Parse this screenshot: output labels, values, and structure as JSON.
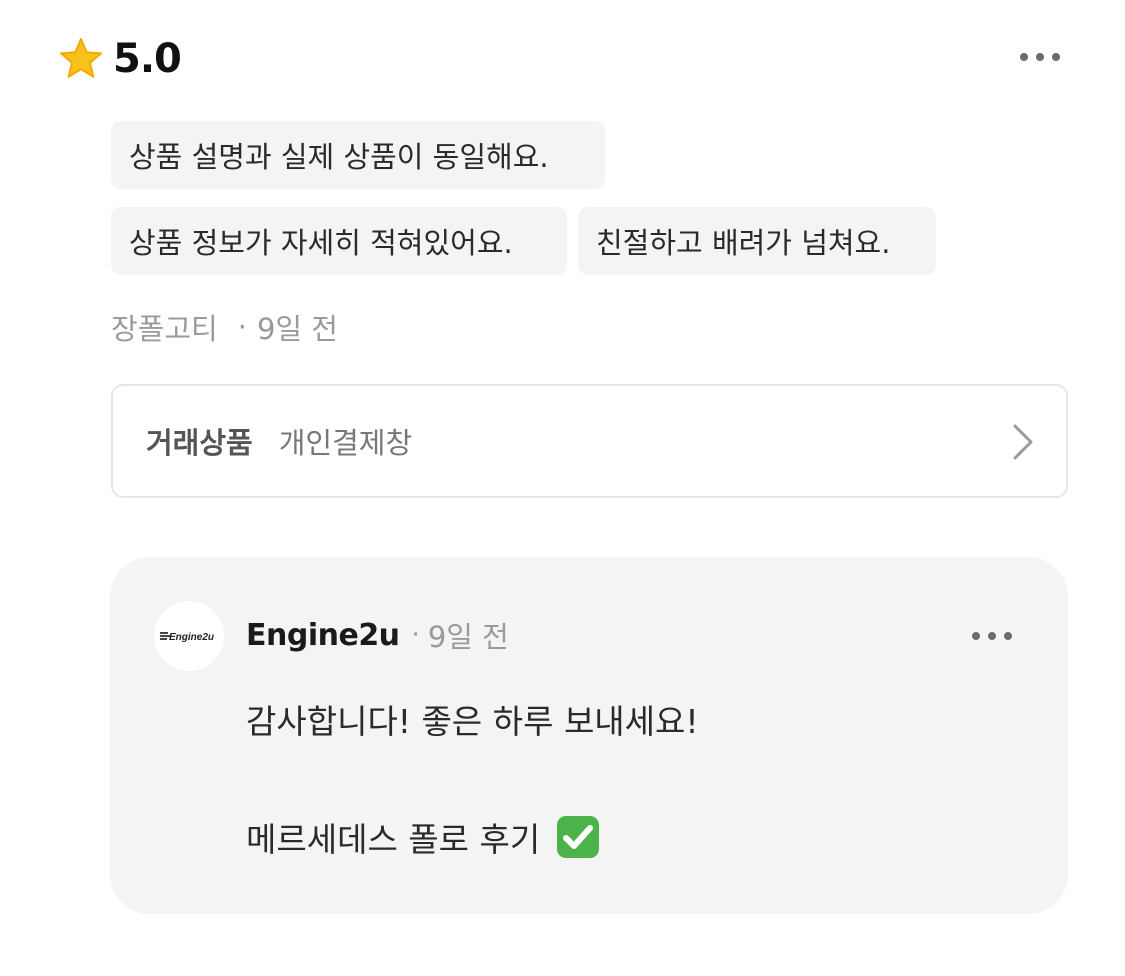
{
  "review": {
    "rating": "5.0",
    "tags": [
      "상품 설명과 실제 상품이 동일해요.",
      "상품 정보가 자세히 적혀있어요.",
      "친절하고 배려가 넘쳐요."
    ],
    "author": "장폴고티",
    "separator": "·",
    "time": "9일 전",
    "product": {
      "label": "거래상품",
      "name": "개인결제창"
    }
  },
  "reply": {
    "author": "Engine2u",
    "separator": "·",
    "time": "9일 전",
    "line1": "감사합니다! 좋은 하루 보내세요!",
    "line2": "메르세데스 폴로 후기",
    "avatar_logo_text": "Engine2u"
  },
  "icons": {
    "rating": "star-icon",
    "more": "more-horizontal-icon",
    "chevron": "chevron-right-icon",
    "check": "check-mark-button-icon"
  },
  "colors": {
    "star": "#F9C11B",
    "chip_bg": "#F4F4F5",
    "card_bg": "#F4F4F5",
    "muted_text": "#9A9A9A",
    "check_green": "#4CB34A"
  }
}
